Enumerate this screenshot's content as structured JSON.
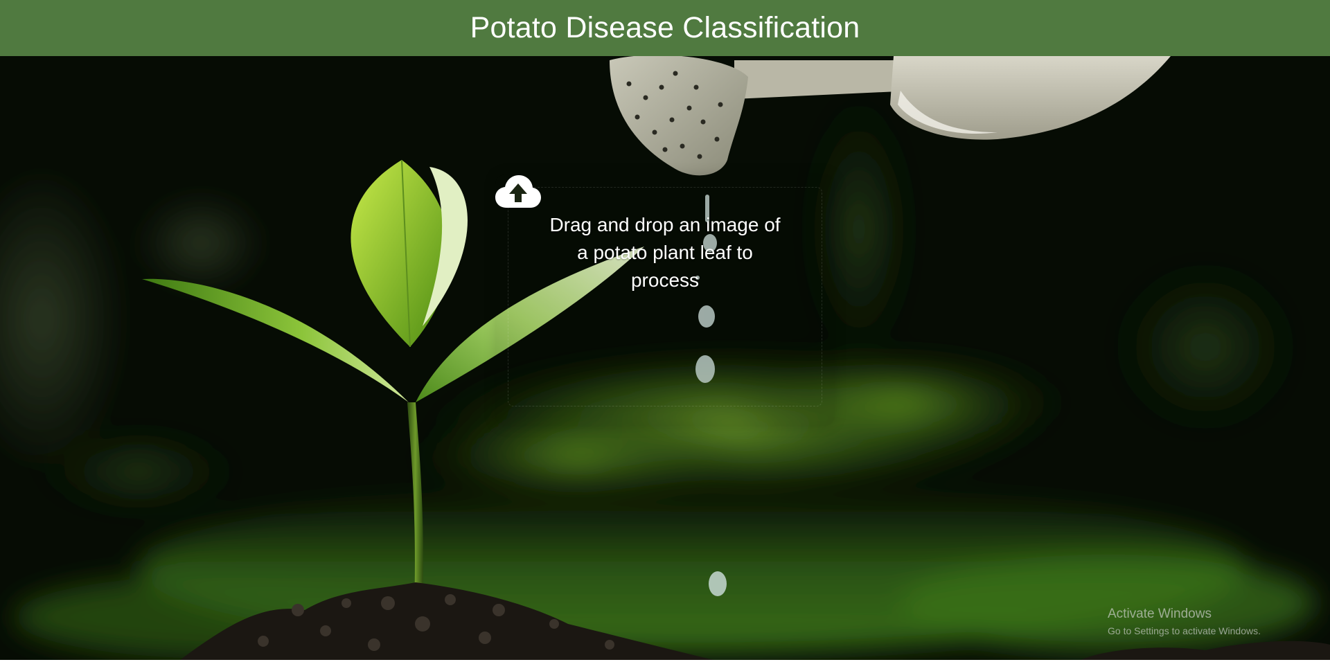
{
  "header": {
    "title": "Potato Disease Classification"
  },
  "dropzone": {
    "instruction": "Drag and drop an image of a potato plant leaf to process",
    "icon": "cloud-upload-icon"
  },
  "background": {
    "subject": "seedling-under-watering-can"
  },
  "os_watermark": {
    "title": "Activate Windows",
    "subtitle": "Go to Settings to activate Windows."
  },
  "colors": {
    "header_bg": "#507a40",
    "header_text": "#ffffff",
    "dropzone_text": "#ffffff"
  }
}
